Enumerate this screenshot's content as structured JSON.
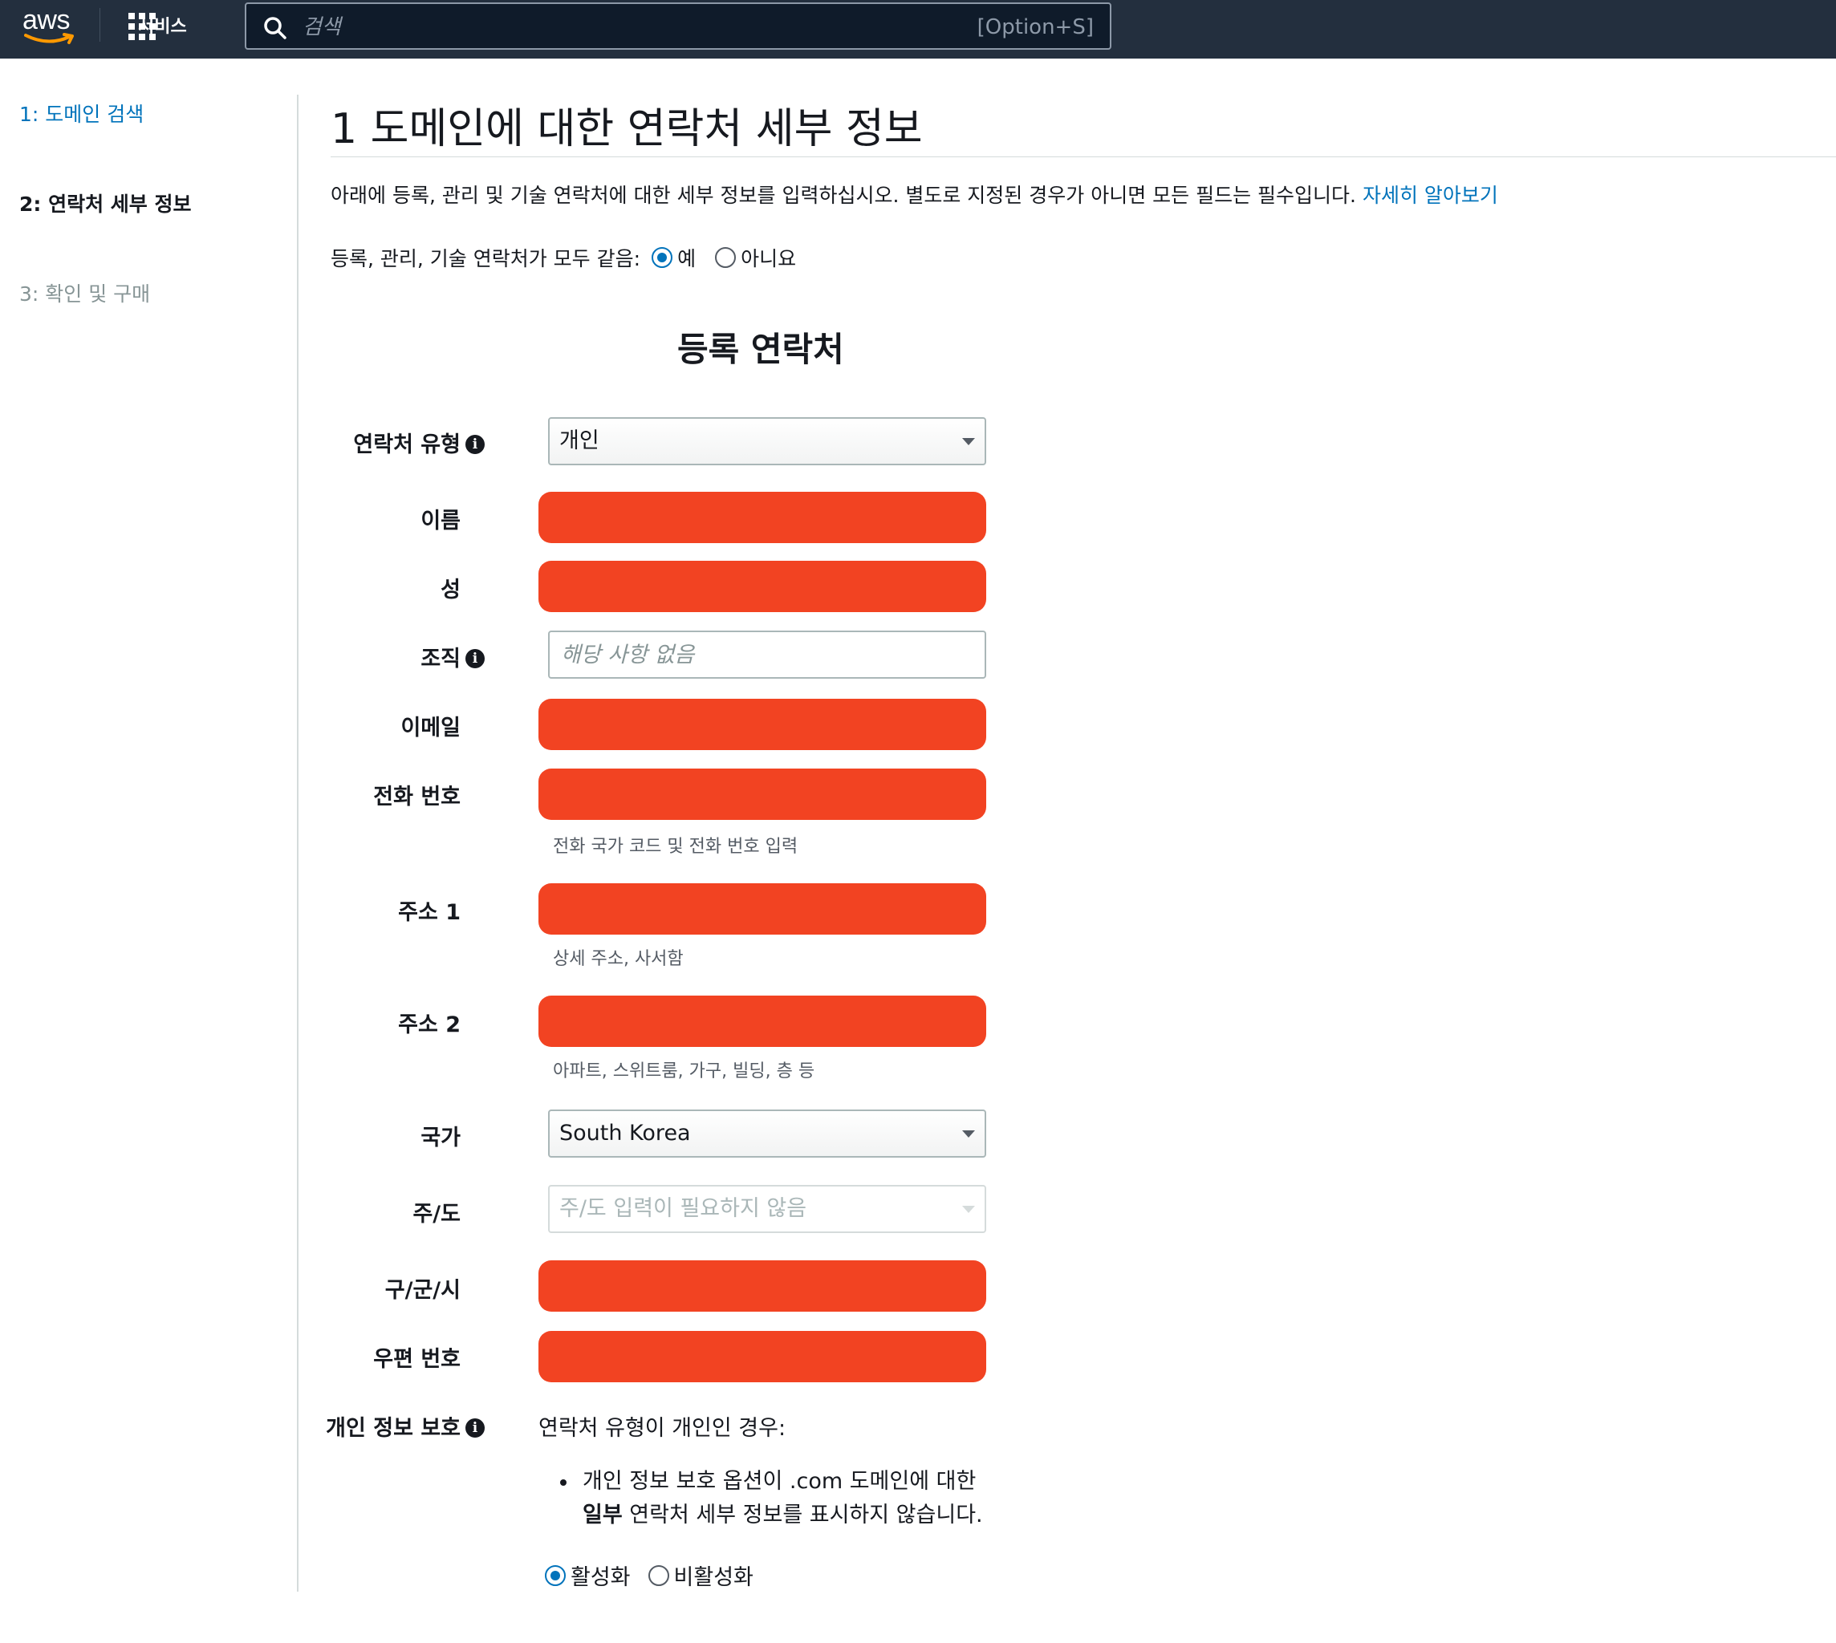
{
  "topnav": {
    "logo_text": "aws",
    "services_label": "서비스",
    "search_placeholder": "검색",
    "search_shortcut": "[Option+S]"
  },
  "sidebar": {
    "steps": [
      {
        "label": "1: 도메인 검색",
        "state": "link"
      },
      {
        "label": "2: 연락처 세부 정보",
        "state": "current"
      },
      {
        "label": "3: 확인 및 구매",
        "state": "disabled"
      }
    ]
  },
  "main": {
    "title": "1 도메인에 대한 연락처 세부 정보",
    "intro_text": "아래에 등록, 관리 및 기술 연락처에 대한 세부 정보를 입력하십시오. 별도로 지정된 경우가 아니면 모든 필드는 필수입니다. ",
    "learn_more": "자세히 알아보기",
    "same_contacts": {
      "label": "등록, 관리, 기술 연락처가 모두 같음:",
      "yes": "예",
      "no": "아니요",
      "selected": "예"
    },
    "section_heading": "등록 연락처"
  },
  "form": {
    "contact_type": {
      "label": "연락처 유형",
      "value": "개인"
    },
    "first_name": {
      "label": "이름"
    },
    "last_name": {
      "label": "성"
    },
    "organization": {
      "label": "조직",
      "placeholder": "해당 사항 없음"
    },
    "email": {
      "label": "이메일"
    },
    "phone": {
      "label": "전화 번호",
      "hint": "전화 국가 코드 및 전화 번호 입력"
    },
    "address1": {
      "label": "주소 1",
      "hint": "상세 주소, 사서함"
    },
    "address2": {
      "label": "주소 2",
      "hint": "아파트, 스위트룸, 가구, 빌딩, 층 등"
    },
    "country": {
      "label": "국가",
      "value": "South Korea"
    },
    "state": {
      "label": "주/도",
      "value": "주/도 입력이 필요하지 않음"
    },
    "city": {
      "label": "구/군/시"
    },
    "postal_code": {
      "label": "우편 번호"
    },
    "privacy": {
      "label": "개인 정보 보호",
      "intro": "연락처 유형이 개인인 경우:",
      "bullet_line1": "개인 정보 보호 옵션이 .com 도메인에 대한",
      "bullet_bold": "일부",
      "bullet_line2_rest": " 연락처 세부 정보를 표시하지 않습니다.",
      "enable": "활성화",
      "disable": "비활성화",
      "selected": "활성화"
    }
  },
  "colors": {
    "nav_bg": "#232f3e",
    "link": "#0073bb",
    "redaction": "#f24322"
  }
}
